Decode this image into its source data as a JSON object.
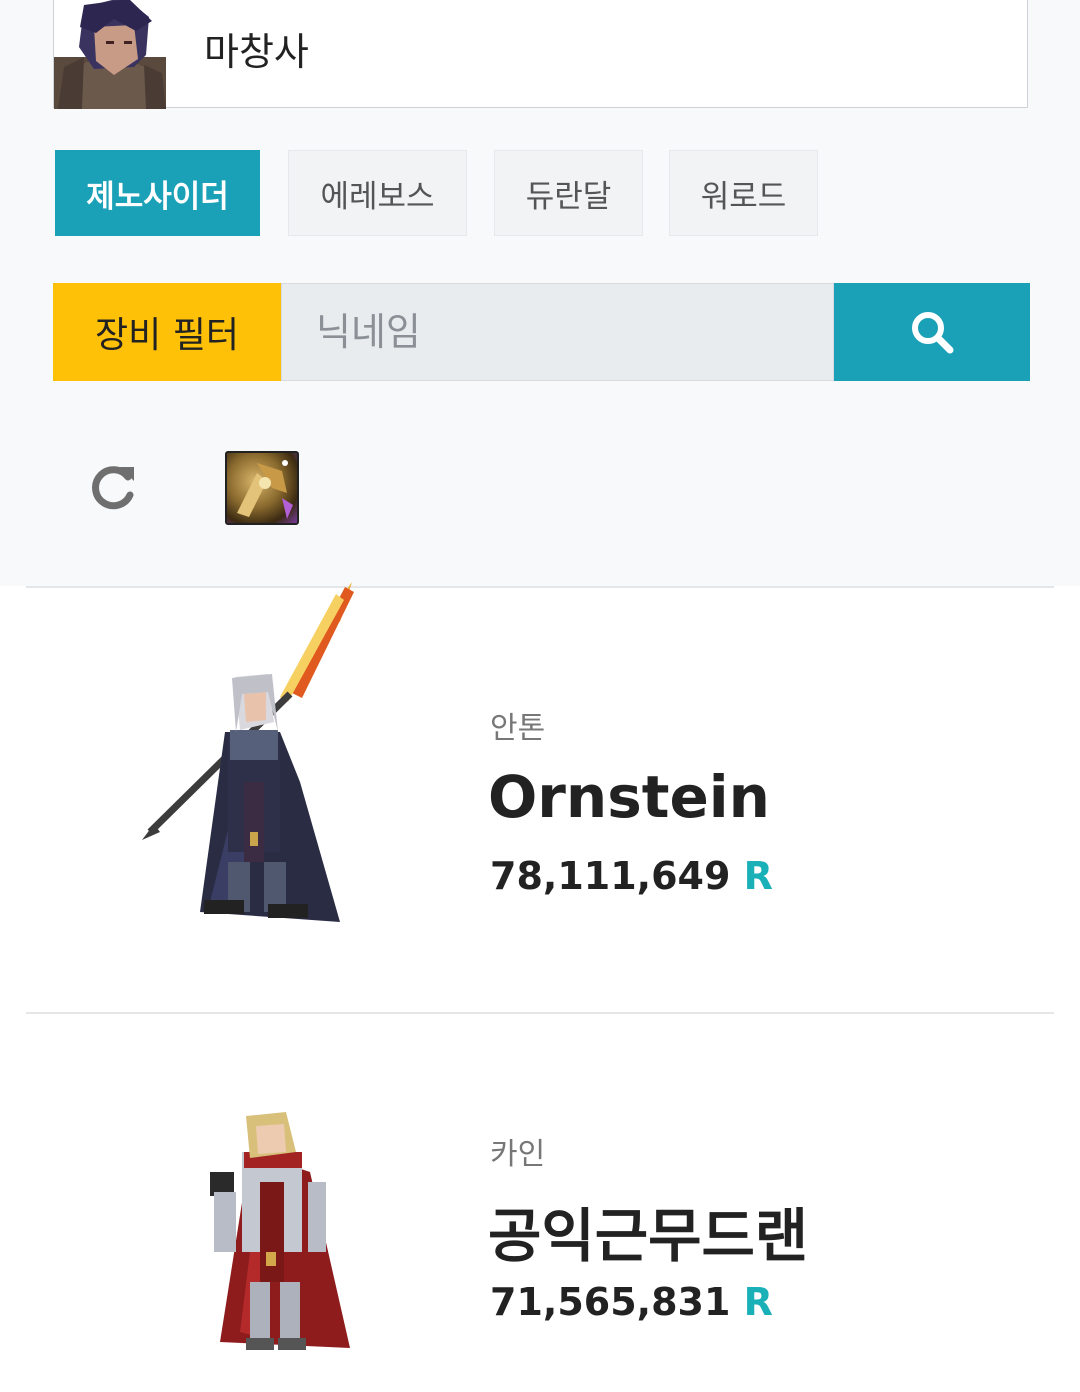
{
  "class_selector": {
    "name": "마창사"
  },
  "server_tabs": [
    {
      "label": "제노사이더",
      "active": true
    },
    {
      "label": "에레보스",
      "active": false
    },
    {
      "label": "듀란달",
      "active": false
    },
    {
      "label": "워로드",
      "active": false
    }
  ],
  "search": {
    "filter_label": "장비 필터",
    "placeholder": "닉네임",
    "button_icon": "search-icon"
  },
  "toolbar": {
    "refresh_icon": "refresh-icon",
    "equipment_icon": "equipment-item-icon"
  },
  "rankings": [
    {
      "guild": "안톤",
      "nickname": "Ornstein",
      "score": "78,111,649",
      "unit": "R"
    },
    {
      "guild": "카인",
      "nickname": "공익근무드랜",
      "score": "71,565,831",
      "unit": "R"
    }
  ],
  "colors": {
    "accent": "#1aa1b8",
    "filter": "#ffc107",
    "unit": "#1ab0b8"
  }
}
